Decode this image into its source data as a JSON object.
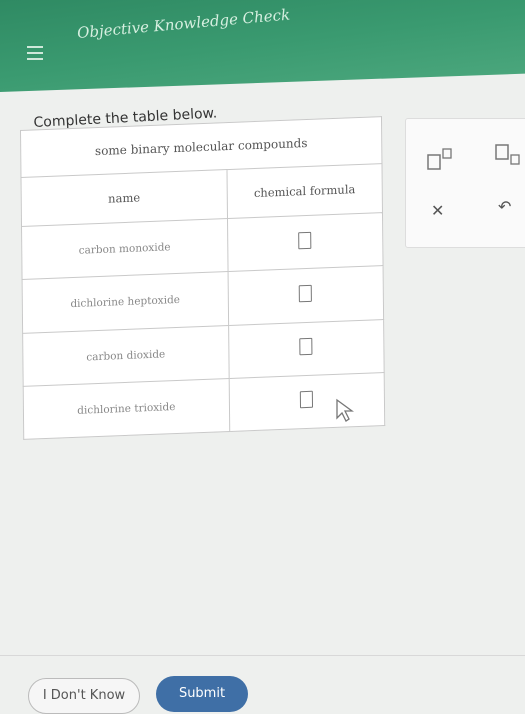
{
  "header": {
    "title": "Objective Knowledge Check",
    "menu_icon": "menu-icon"
  },
  "instruction": "Complete the table below.",
  "table": {
    "caption": "some binary molecular compounds",
    "headers": [
      "name",
      "chemical formula"
    ],
    "rows": [
      {
        "name": "carbon monoxide"
      },
      {
        "name": "dichlorine heptoxide"
      },
      {
        "name": "carbon dioxide"
      },
      {
        "name": "dichlorine trioxide"
      }
    ]
  },
  "side_panel": {
    "icons": [
      "superscript-icon",
      "subscript-icon",
      "clear-icon",
      "undo-icon"
    ]
  },
  "footer": {
    "dont_know": "I Don't Know",
    "submit": "Submit"
  }
}
